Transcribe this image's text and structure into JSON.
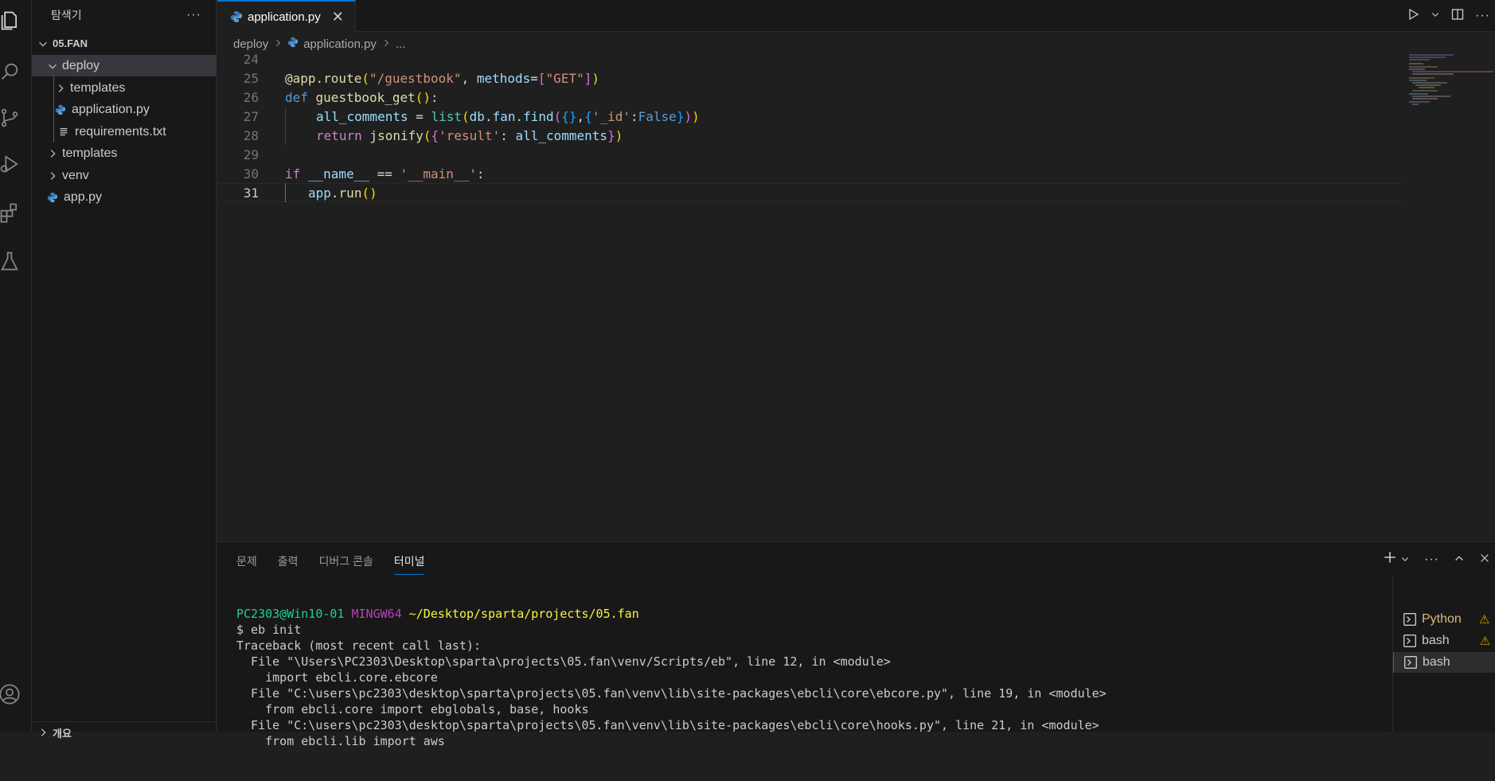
{
  "sidebar": {
    "title": "탐색기",
    "more": "···",
    "root": "05.FAN",
    "items": [
      {
        "label": "deploy",
        "type": "folder-open"
      },
      {
        "label": "templates",
        "type": "folder"
      },
      {
        "label": "application.py",
        "type": "python"
      },
      {
        "label": "requirements.txt",
        "type": "text"
      },
      {
        "label": "templates",
        "type": "folder"
      },
      {
        "label": "venv",
        "type": "folder"
      },
      {
        "label": "app.py",
        "type": "python"
      }
    ],
    "bottom_partial": "개요"
  },
  "tab": {
    "label": "application.py",
    "close": "✕"
  },
  "breadcrumb": {
    "folder": "deploy",
    "file": "application.py",
    "more": "..."
  },
  "editor": {
    "line_numbers": [
      "24",
      "25",
      "26",
      "27",
      "28",
      "29",
      "30",
      "31"
    ],
    "current_line": "31"
  },
  "code": {
    "l25": {
      "decorator": "@app.route",
      "p1": "(",
      "s1": "\"/guestbook\"",
      "comma": ", ",
      "kwarg": "methods",
      "eq": "=",
      "b1": "[",
      "s2": "\"GET\"",
      "b2": "]",
      "p2": ")"
    },
    "l26": {
      "def": "def",
      "name": " guestbook_get",
      "parens": "()",
      "colon": ":"
    },
    "l27": {
      "var": "all_comments",
      "eq": " = ",
      "list": "list",
      "p1": "(",
      "db": "db.fan.find",
      "p2": "(",
      "b1": "{}",
      "comma": ",",
      "b2": "{",
      "key": "'_id'",
      "colon": ":",
      "val": "False",
      "b3": "}",
      "p3": ")",
      "p4": ")"
    },
    "l28": {
      "ret": "return",
      "fn": " jsonify",
      "p1": "(",
      "b1": "{",
      "key": "'result'",
      "colon": ": ",
      "var": "all_comments",
      "b2": "}",
      "p2": ")"
    },
    "l30": {
      "if": "if",
      "name": " __name__",
      "eq": " == ",
      "s": "'__main__'",
      "colon": ":"
    },
    "l31": {
      "obj": "app",
      "dot": ".",
      "fn": "run",
      "parens": "()"
    }
  },
  "panel": {
    "tabs": [
      "문제",
      "출력",
      "디버그 콘솔",
      "터미널"
    ],
    "active_tab": "터미널"
  },
  "terminal": {
    "user": "PC2303@Win10-01",
    "shell": "MINGW64",
    "path": "~/Desktop/sparta/projects/05.fan",
    "lines": [
      "$ eb init",
      "Traceback (most recent call last):",
      "  File \"\\Users\\PC2303\\Desktop\\sparta\\projects\\05.fan\\venv/Scripts/eb\", line 12, in <module>",
      "    import ebcli.core.ebcore",
      "  File \"C:\\users\\pc2303\\desktop\\sparta\\projects\\05.fan\\venv\\lib\\site-packages\\ebcli\\core\\ebcore.py\", line 19, in <module>",
      "    from ebcli.core import ebglobals, base, hooks",
      "  File \"C:\\users\\pc2303\\desktop\\sparta\\projects\\05.fan\\venv\\lib\\site-packages\\ebcli\\core\\hooks.py\", line 21, in <module>",
      "    from ebcli.lib import aws"
    ]
  },
  "terminal_list": [
    {
      "label": "Python",
      "warn": "⚠"
    },
    {
      "label": "bash",
      "warn": "⚠"
    },
    {
      "label": "bash",
      "warn": ""
    }
  ],
  "colors": {
    "accent": "#0078d4",
    "bg": "#1f1f1f",
    "sidebar_bg": "#181818"
  }
}
